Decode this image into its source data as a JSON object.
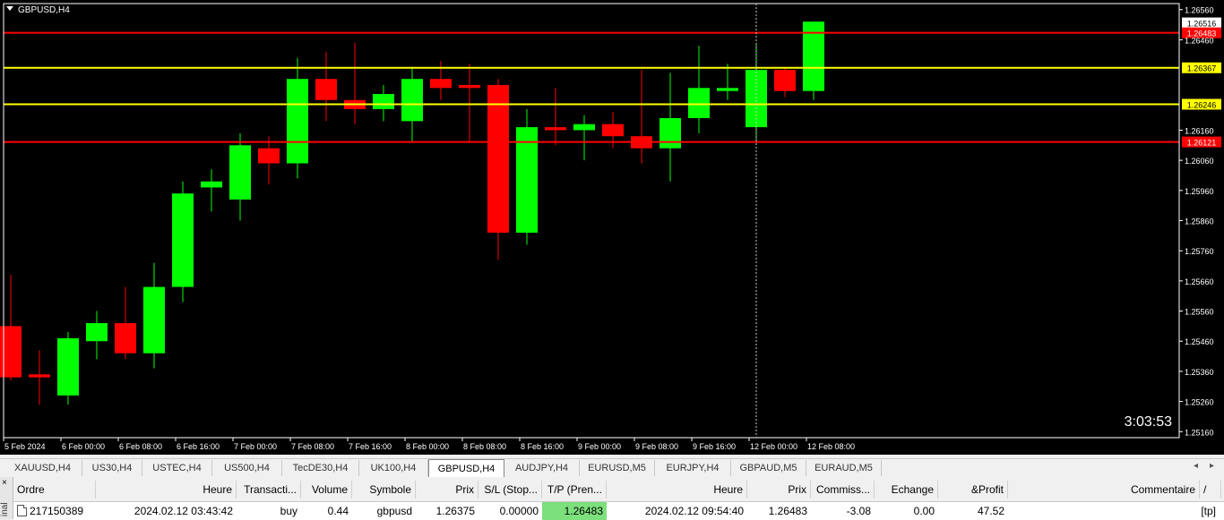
{
  "chart": {
    "symbol_label": "GBPUSD,H4",
    "countdown": "3:03:53",
    "colors": {
      "bull": "#00ff00",
      "bear": "#ff0000",
      "background": "#000000",
      "grid_text": "#ffffff",
      "support_line": "#ffff00",
      "tp_sl_line": "#ff0000"
    },
    "price_ticks": [
      "1.26560",
      "1.26460",
      "1.26160",
      "1.26060",
      "1.25960",
      "1.25860",
      "1.25760",
      "1.25660",
      "1.25560",
      "1.25460",
      "1.25360",
      "1.25260",
      "1.25160"
    ],
    "time_ticks": [
      "5 Feb 2024",
      "6 Feb 00:00",
      "6 Feb 08:00",
      "6 Feb 16:00",
      "7 Feb 00:00",
      "7 Feb 08:00",
      "7 Feb 16:00",
      "8 Feb 00:00",
      "8 Feb 08:00",
      "8 Feb 16:00",
      "9 Feb 00:00",
      "9 Feb 08:00",
      "9 Feb 16:00",
      "12 Feb 00:00",
      "12 Feb 08:00"
    ],
    "levels": [
      {
        "label": "1.26516",
        "price": 1.26516,
        "type": "bid",
        "color": "#ffffff"
      },
      {
        "label": "1.26483",
        "price": 1.26483,
        "type": "tp",
        "color": "#ff0000"
      },
      {
        "label": "1.26367",
        "price": 1.26367,
        "type": "support",
        "color": "#ffff00"
      },
      {
        "label": "1.26246",
        "price": 1.26246,
        "type": "support",
        "color": "#ffff00"
      },
      {
        "label": "1.26121",
        "price": 1.26121,
        "type": "resistance",
        "color": "#ff0000"
      }
    ]
  },
  "chart_data": {
    "type": "candlestick",
    "title": "GBPUSD,H4",
    "y_range": [
      1.2514,
      1.2658
    ],
    "candles": [
      {
        "o": 1.2551,
        "h": 1.2568,
        "l": 1.2533,
        "c": 1.2534
      },
      {
        "o": 1.2535,
        "h": 1.2543,
        "l": 1.2525,
        "c": 1.2534
      },
      {
        "o": 1.2528,
        "h": 1.2549,
        "l": 1.2525,
        "c": 1.2547
      },
      {
        "o": 1.2546,
        "h": 1.2556,
        "l": 1.254,
        "c": 1.2552
      },
      {
        "o": 1.2552,
        "h": 1.2564,
        "l": 1.254,
        "c": 1.2542
      },
      {
        "o": 1.2542,
        "h": 1.2572,
        "l": 1.2537,
        "c": 1.2564
      },
      {
        "o": 1.2564,
        "h": 1.2599,
        "l": 1.2559,
        "c": 1.2595
      },
      {
        "o": 1.2597,
        "h": 1.2603,
        "l": 1.2589,
        "c": 1.2599
      },
      {
        "o": 1.2593,
        "h": 1.2615,
        "l": 1.2586,
        "c": 1.2611
      },
      {
        "o": 1.261,
        "h": 1.2614,
        "l": 1.2598,
        "c": 1.2605
      },
      {
        "o": 1.2605,
        "h": 1.264,
        "l": 1.26,
        "c": 1.2633
      },
      {
        "o": 1.2633,
        "h": 1.2642,
        "l": 1.2619,
        "c": 1.2626
      },
      {
        "o": 1.2626,
        "h": 1.2645,
        "l": 1.2618,
        "c": 1.2623
      },
      {
        "o": 1.2623,
        "h": 1.2631,
        "l": 1.2619,
        "c": 1.2628
      },
      {
        "o": 1.2619,
        "h": 1.2637,
        "l": 1.2612,
        "c": 1.2633
      },
      {
        "o": 1.2633,
        "h": 1.2639,
        "l": 1.2626,
        "c": 1.263
      },
      {
        "o": 1.2631,
        "h": 1.2638,
        "l": 1.2612,
        "c": 1.263
      },
      {
        "o": 1.2631,
        "h": 1.2633,
        "l": 1.2573,
        "c": 1.2582
      },
      {
        "o": 1.2582,
        "h": 1.2623,
        "l": 1.2578,
        "c": 1.2617
      },
      {
        "o": 1.2617,
        "h": 1.263,
        "l": 1.2611,
        "c": 1.2616
      },
      {
        "o": 1.2616,
        "h": 1.2621,
        "l": 1.2606,
        "c": 1.2618
      },
      {
        "o": 1.2618,
        "h": 1.2622,
        "l": 1.261,
        "c": 1.2614
      },
      {
        "o": 1.2614,
        "h": 1.2636,
        "l": 1.2605,
        "c": 1.261
      },
      {
        "o": 1.261,
        "h": 1.2635,
        "l": 1.2599,
        "c": 1.262
      },
      {
        "o": 1.262,
        "h": 1.2644,
        "l": 1.2615,
        "c": 1.263
      },
      {
        "o": 1.2629,
        "h": 1.2638,
        "l": 1.2626,
        "c": 1.263
      },
      {
        "o": 1.2617,
        "h": 1.2645,
        "l": 1.2612,
        "c": 1.2636
      },
      {
        "o": 1.2636,
        "h": 1.2637,
        "l": 1.2627,
        "c": 1.2629
      },
      {
        "o": 1.2629,
        "h": 1.2652,
        "l": 1.2626,
        "c": 1.2652
      }
    ]
  },
  "tabs": {
    "items": [
      "XAUUSD,H4",
      "US30,H4",
      "USTEC,H4",
      "US500,H4",
      "TecDE30,H4",
      "UK100,H4",
      "GBPUSD,H4",
      "AUDJPY,H4",
      "EURUSD,M5",
      "EURJPY,H4",
      "GBPAUD,M5",
      "EURAUD,M5"
    ],
    "active": "GBPUSD,H4",
    "prev_arrow": "◂",
    "next_arrow": "▸"
  },
  "terminal": {
    "close_glyph": "×",
    "side_label": "inal",
    "headers": {
      "ordre": "Ordre",
      "heure": "Heure",
      "transaction": "Transacti...",
      "volume": "Volume",
      "symbole": "Symbole",
      "prix": "Prix",
      "sl": "S/L (Stop...",
      "tp": "T/P (Pren...",
      "heure2": "Heure",
      "prix2": "Prix",
      "commission": "Commiss...",
      "echange": "Echange",
      "profit": "&Profit",
      "commentaire": "Commentaire",
      "sort_glyph": "/"
    },
    "row": {
      "ordre": "217150389",
      "heure": "2024.02.12 03:43:42",
      "transaction": "buy",
      "volume": "0.44",
      "symbole": "gbpusd",
      "prix": "1.26375",
      "sl": "0.00000",
      "tp": "1.26483",
      "heure2": "2024.02.12 09:54:40",
      "prix2": "1.26483",
      "commission": "-3.08",
      "echange": "0.00",
      "profit": "47.52",
      "commentaire": "[tp]"
    },
    "tp_highlight_color": "#7ce07c"
  }
}
